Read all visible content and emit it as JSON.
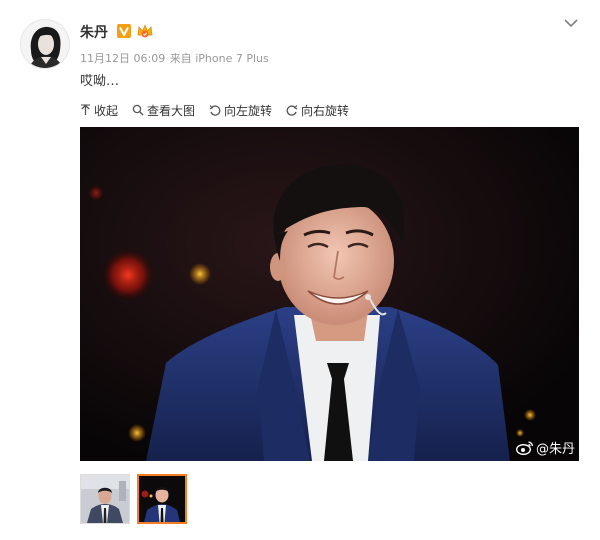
{
  "post": {
    "username": "朱丹",
    "badge_v_color": "#f59f14",
    "timestamp": "11月12日 06:09",
    "source_prefix": "来自",
    "source": "iPhone 7 Plus",
    "text": "哎呦…"
  },
  "toolbar": {
    "collapse_label": "收起",
    "view_large_label": "查看大图",
    "rotate_left_label": "向左旋转",
    "rotate_right_label": "向右旋转"
  },
  "photo": {
    "watermark": "@朱丹"
  },
  "thumbnails": {
    "selected_index": 1,
    "selected_border_color": "#f57d22"
  }
}
